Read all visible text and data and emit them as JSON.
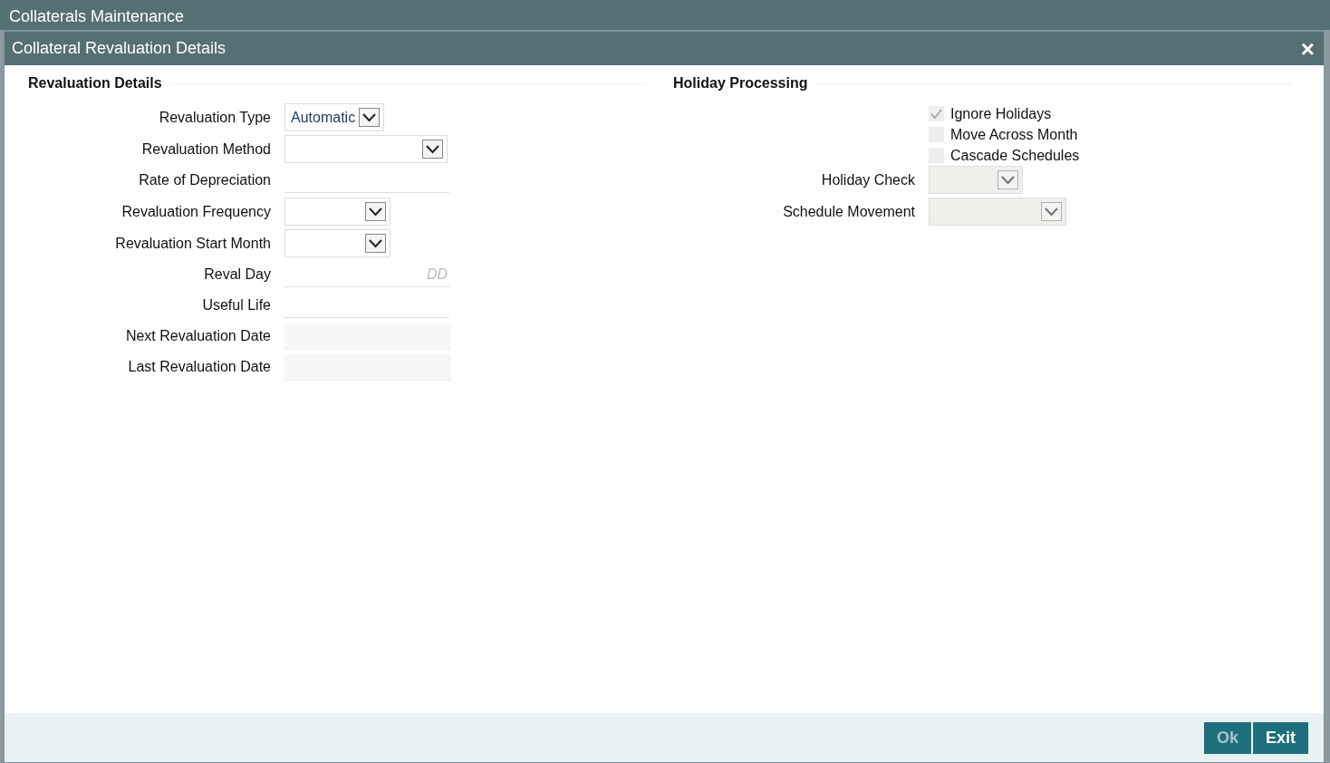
{
  "window": {
    "title": "Collaterals Maintenance"
  },
  "dialog": {
    "title": "Collateral Revaluation Details",
    "close": "×"
  },
  "revaluation_details": {
    "title": "Revaluation Details",
    "fields": [
      {
        "label": "Revaluation Type",
        "kind": "select",
        "value": "Automatic",
        "disabled": false
      },
      {
        "label": "Revaluation Method",
        "kind": "select",
        "disabled": false
      },
      {
        "label": "Rate of Depreciation",
        "kind": "text"
      },
      {
        "label": "Revaluation Frequency",
        "kind": "select",
        "disabled": false
      },
      {
        "label": "Revaluation Start Month",
        "kind": "select",
        "disabled": false
      },
      {
        "label": "Reval Day",
        "kind": "text",
        "placeholder": "DD"
      },
      {
        "label": "Useful Life",
        "kind": "text"
      },
      {
        "label": "Next Revaluation Date",
        "kind": "readonly"
      },
      {
        "label": "Last Revaluation Date",
        "kind": "readonly"
      }
    ]
  },
  "holiday_processing": {
    "title": "Holiday Processing",
    "checkboxes": [
      {
        "label": "Ignore Holidays",
        "checked": true,
        "disabled": true
      },
      {
        "label": "Move Across Month",
        "checked": false,
        "disabled": true
      },
      {
        "label": "Cascade Schedules",
        "checked": false,
        "disabled": true
      }
    ],
    "fields": [
      {
        "label": "Holiday Check",
        "kind": "select",
        "disabled": true
      },
      {
        "label": "Schedule Movement",
        "kind": "select",
        "disabled": true
      }
    ]
  },
  "buttons": [
    {
      "label": "Ok",
      "disabled": true
    },
    {
      "label": "Exit",
      "disabled": false
    }
  ]
}
